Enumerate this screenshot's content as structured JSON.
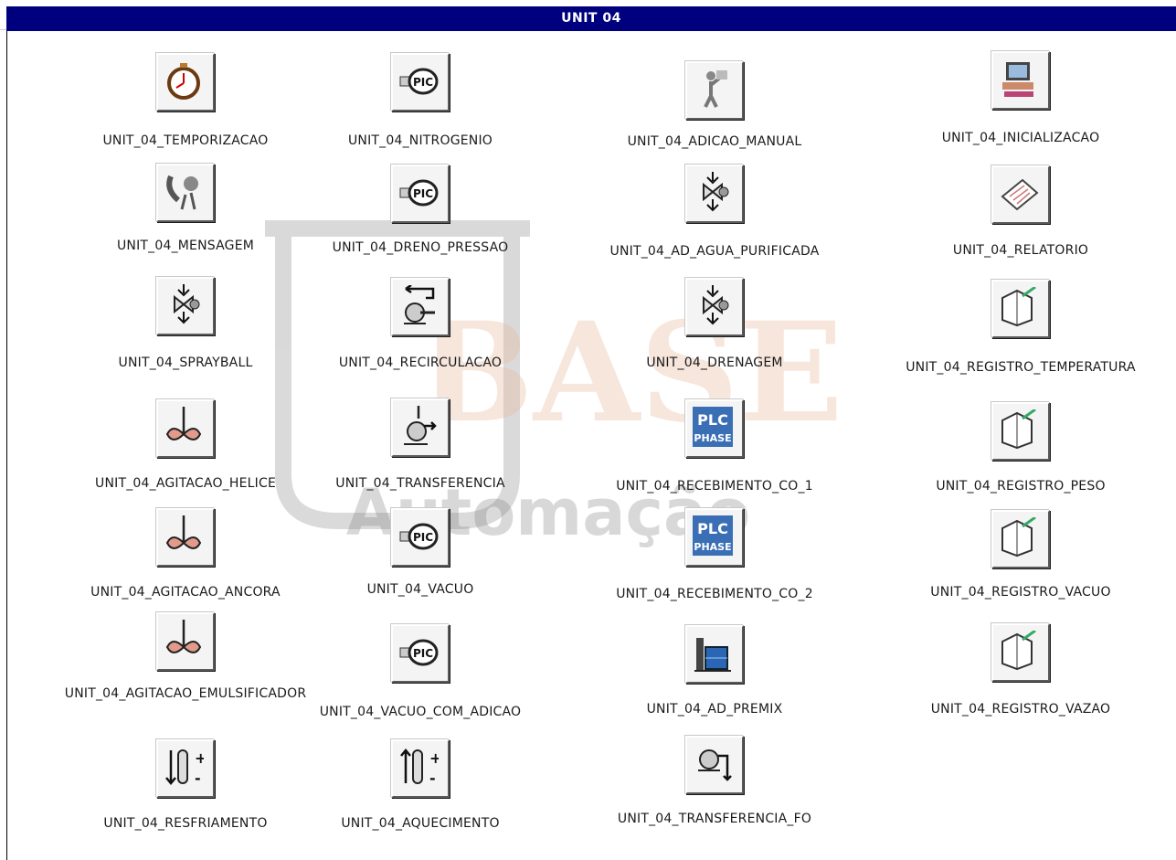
{
  "window": {
    "title": "UNIT 04"
  },
  "watermark": {
    "line1": "BASE",
    "line2": "Automação"
  },
  "items": [
    {
      "label": "UNIT_04_TEMPORIZACAO",
      "icon": "stopwatch-icon"
    },
    {
      "label": "UNIT_04_NITROGENIO",
      "icon": "pic-gauge-icon"
    },
    {
      "label": "UNIT_04_ADICAO_MANUAL",
      "icon": "operator-lifting-icon"
    },
    {
      "label": "UNIT_04_INICIALIZACAO",
      "icon": "computer-icon"
    },
    {
      "label": "UNIT_04_MENSAGEM",
      "icon": "phone-call-icon"
    },
    {
      "label": "UNIT_04_DRENO_PRESSAO",
      "icon": "pic-gauge-icon"
    },
    {
      "label": "UNIT_04_AD_AGUA_PURIFICADA",
      "icon": "valve-icon"
    },
    {
      "label": "UNIT_04_RELATORIO",
      "icon": "report-paper-icon"
    },
    {
      "label": "UNIT_04_SPRAYBALL",
      "icon": "valve-icon"
    },
    {
      "label": "UNIT_04_RECIRCULACAO",
      "icon": "recirculation-pump-icon"
    },
    {
      "label": "UNIT_04_DRENAGEM",
      "icon": "valve-icon"
    },
    {
      "label": "UNIT_04_REGISTRO_TEMPERATURA",
      "icon": "registry-book-icon"
    },
    {
      "label": "UNIT_04_AGITACAO_HELICE",
      "icon": "agitator-icon"
    },
    {
      "label": "UNIT_04_TRANSFERENCIA",
      "icon": "transfer-pump-icon"
    },
    {
      "label": "UNIT_04_RECEBIMENTO_CO_1",
      "icon": "plc-phase-icon",
      "plc_top": "PLC",
      "plc_bottom": "PHASE"
    },
    {
      "label": "UNIT_04_REGISTRO_PESO",
      "icon": "registry-book-icon"
    },
    {
      "label": "UNIT_04_AGITACAO_ANCORA",
      "icon": "agitator-icon"
    },
    {
      "label": "UNIT_04_VACUO",
      "icon": "pic-gauge-icon"
    },
    {
      "label": "UNIT_04_RECEBIMENTO_CO_2",
      "icon": "plc-phase-icon",
      "plc_top": "PLC",
      "plc_bottom": "PHASE"
    },
    {
      "label": "UNIT_04_REGISTRO_VACUO",
      "icon": "registry-book-icon"
    },
    {
      "label": "UNIT_04_AGITACAO_EMULSIFICADOR",
      "icon": "agitator-icon"
    },
    {
      "label": "UNIT_04_VACUO_COM_ADICAO",
      "icon": "pic-gauge-icon"
    },
    {
      "label": "UNIT_04_AD_PREMIX",
      "icon": "premix-drum-icon"
    },
    {
      "label": "UNIT_04_REGISTRO_VAZAO",
      "icon": "registry-book-icon"
    },
    {
      "label": "UNIT_04_RESFRIAMENTO",
      "icon": "cooling-thermometer-icon"
    },
    {
      "label": "UNIT_04_AQUECIMENTO",
      "icon": "heating-thermometer-icon"
    },
    {
      "label": "UNIT_04_TRANSFERENCIA_FO",
      "icon": "transfer-out-icon"
    }
  ]
}
